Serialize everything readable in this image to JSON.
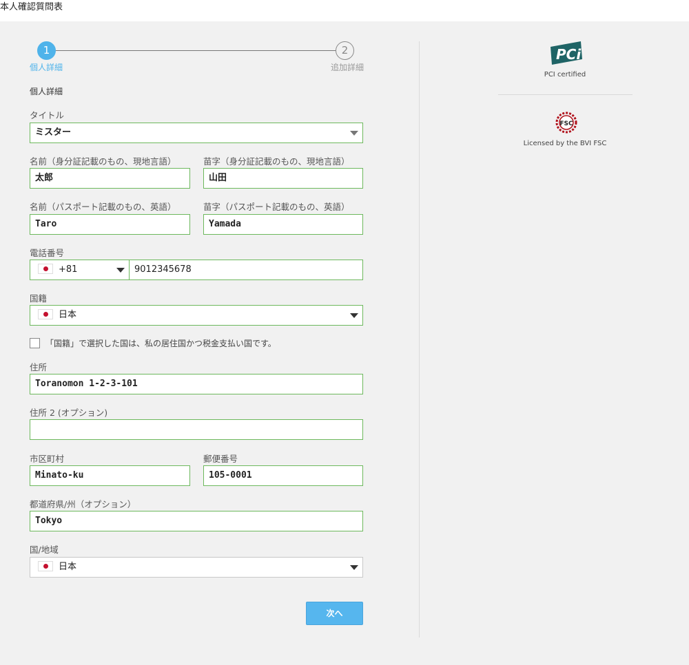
{
  "page": {
    "title": "本人確認質問表"
  },
  "stepper": {
    "steps": [
      {
        "number": "1",
        "label": "個人詳細"
      },
      {
        "number": "2",
        "label": "追加詳細"
      }
    ]
  },
  "form": {
    "section_title": "個人詳細",
    "title_field": {
      "label": "タイトル",
      "value": "ミスター"
    },
    "first_name_local": {
      "label": "名前（身分証記載のもの、現地言語）",
      "value": "太郎"
    },
    "last_name_local": {
      "label": "苗字（身分証記載のもの、現地言語）",
      "value": "山田"
    },
    "first_name_en": {
      "label": "名前（パスポート記載のもの、英語）",
      "value": "Taro"
    },
    "last_name_en": {
      "label": "苗字（パスポート記載のもの、英語）",
      "value": "Yamada"
    },
    "phone": {
      "label": "電話番号",
      "country_code": "+81",
      "number": "9012345678"
    },
    "nationality": {
      "label": "国籍",
      "value": "日本"
    },
    "tax_checkbox": {
      "label": "「国籍」で選択した国は、私の居住国かつ税金支払い国です。",
      "checked": false
    },
    "address1": {
      "label": "住所",
      "value": "Toranomon 1-2-3-101"
    },
    "address2": {
      "label": "住所 2 (オプション)",
      "value": ""
    },
    "city": {
      "label": "市区町村",
      "value": "Minato-ku"
    },
    "postal_code": {
      "label": "郵便番号",
      "value": "105-0001"
    },
    "state": {
      "label": "都道府県/州（オプション）",
      "value": "Tokyo"
    },
    "country": {
      "label": "国/地域",
      "value": "日本"
    },
    "next_label": "次へ"
  },
  "sidebar": {
    "pci_caption": "PCI certified",
    "pci_logo_text": "PCi",
    "fsc_caption": "Licensed by the BVI FSC",
    "fsc_logo_text": "FSC"
  },
  "colors": {
    "accent": "#4fb3ea",
    "valid_border": "#6cb85c",
    "flag_red": "#c4112f",
    "pci_teal": "#1f6466",
    "fsc_red": "#b1121c"
  }
}
